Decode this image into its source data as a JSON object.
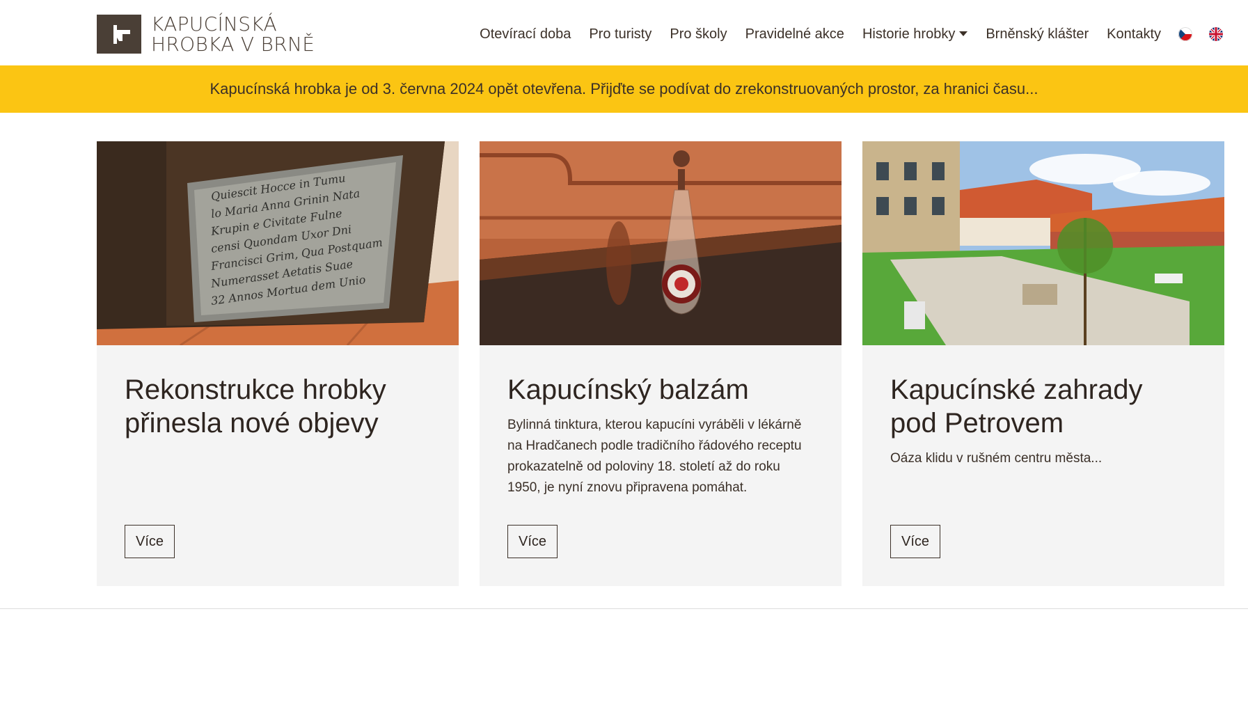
{
  "header": {
    "logo_line1": "KAPUCÍNSKÁ",
    "logo_line2": "HROBKA V BRNĚ",
    "nav": [
      {
        "label": "Otevírací doba"
      },
      {
        "label": "Pro turisty"
      },
      {
        "label": "Pro školy"
      },
      {
        "label": "Pravidelné akce"
      },
      {
        "label": "Historie hrobky"
      },
      {
        "label": "Brněnský klášter"
      },
      {
        "label": "Kontakty"
      }
    ],
    "languages": [
      "cz-flag-icon",
      "uk-flag-icon"
    ]
  },
  "banner": {
    "text": "Kapucínská hrobka je od 3. června 2024 opět otevřena. Přijďte se podívat do zrekonstruovaných prostor, za hranici času...",
    "color": "#fbc513"
  },
  "cards": [
    {
      "title": "Rekonstrukce hrobky přinesla nové objevy",
      "text": "",
      "button": "Více",
      "image": "inscription-plaque-photo"
    },
    {
      "title": "Kapucínský balzám",
      "text": "Bylinná tinktura, kterou kapucíni vyráběli v lékárně na Hradčanech podle tradičního řádového receptu prokazatelně od poloviny 18. století až do roku 1950, je nyní znovu připravena pomáhat.",
      "button": "Více",
      "image": "balsam-bottle-photo"
    },
    {
      "title": "Kapucínské zahrady pod Petrovem",
      "text": "Oáza klidu v rušném centru města...",
      "button": "Více",
      "image": "garden-photo"
    }
  ],
  "colors": {
    "brand": "#4a3f36",
    "accent": "#fbc513",
    "card_bg": "#f4f4f4"
  }
}
